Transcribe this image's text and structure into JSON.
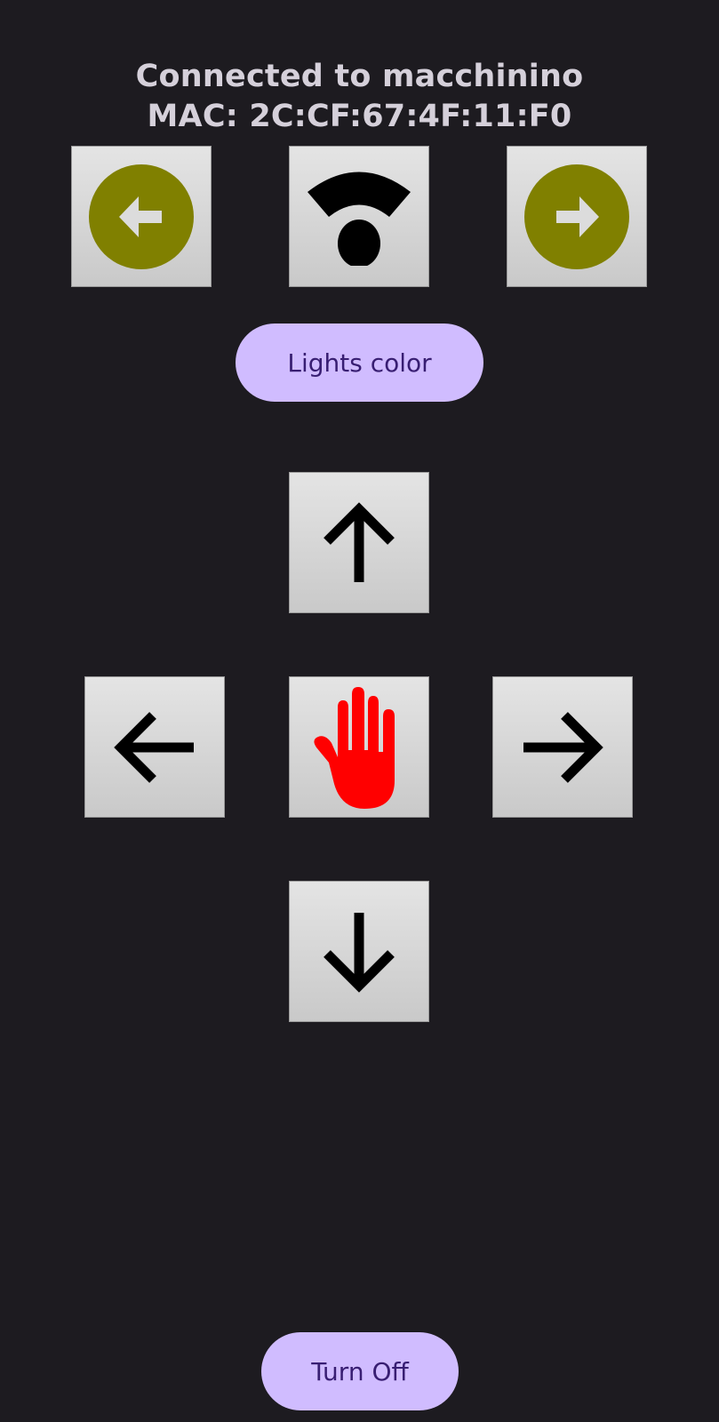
{
  "header": {
    "connected_text": "Connected to macchinino",
    "mac_text": "MAC: 2C:CF:67:4F:11:F0"
  },
  "top_controls": {
    "left_icon": "circle-arrow-left-icon",
    "center_icon": "wifi-signal-icon",
    "right_icon": "circle-arrow-right-icon"
  },
  "lights_button": {
    "label": "Lights color"
  },
  "dpad": {
    "up_icon": "arrow-up-icon",
    "left_icon": "arrow-left-icon",
    "stop_icon": "stop-hand-icon",
    "right_icon": "arrow-right-icon",
    "down_icon": "arrow-down-icon"
  },
  "turn_off_button": {
    "label": "Turn Off"
  },
  "colors": {
    "background": "#1d1b20",
    "olive": "#808000",
    "pill": "#d0bcff",
    "pill_text": "#381e72",
    "stop": "#ff0000"
  }
}
